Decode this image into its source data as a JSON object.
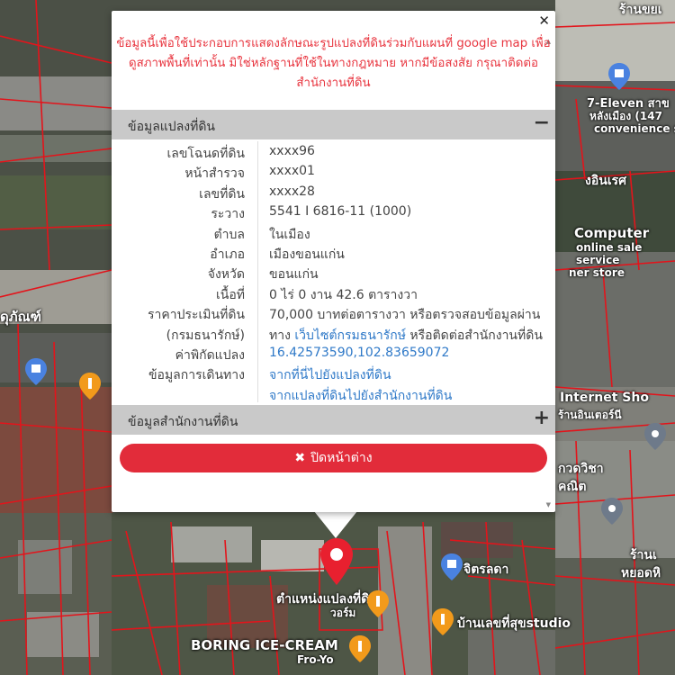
{
  "popup": {
    "close_glyph": "✕",
    "disclaimer": "ข้อมูลนี้เพื่อใช้ประกอบการแสดงลักษณะรูปแปลงที่ดินร่วมกับแผนที่ google map เพื่อดูสภาพพื้นที่เท่านั้น มิใช่หลักฐานที่ใช้ในทางกฎหมาย หากมีข้อสงสัย กรุณาติดต่อสำนักงานที่ดิน",
    "panel1": {
      "title": "ข้อมูลแปลงที่ดิน",
      "toggle": "−",
      "rows": [
        {
          "label": "เลขโฉนดที่ดิน",
          "value": "xxxx96"
        },
        {
          "label": "หน้าสำรวจ",
          "value": "xxxx01"
        },
        {
          "label": "เลขที่ดิน",
          "value": "xxxx28"
        },
        {
          "label": "ระวาง",
          "value": "5541 I 6816-11 (1000)"
        },
        {
          "label": "ตำบล",
          "value": "ในเมือง"
        },
        {
          "label": "อำเภอ",
          "value": "เมืองขอนแก่น"
        },
        {
          "label": "จังหวัด",
          "value": "ขอนแก่น"
        },
        {
          "label": "เนื้อที่",
          "value": "0 ไร่ 0 งาน 42.6 ตารางวา"
        }
      ],
      "price": {
        "label_line1": "ราคาประเมินที่ดิน",
        "label_line2": "(กรมธนารักษ์)",
        "value_line1": "70,000 บาทต่อตารางวา หรือตรวจสอบข้อมูลผ่าน",
        "value_line2_pre": "ทาง ",
        "value_line2_link": "เว็บไซต์กรมธนารักษ์",
        "value_line2_post": " หรือติดต่อสำนักงานที่ดิน"
      },
      "coords": {
        "label": "ค่าพิกัดแปลง",
        "value": "16.42573590,102.83659072"
      },
      "travel": {
        "label": "ข้อมูลการเดินทาง",
        "link1": "จากที่นี่ไปยังแปลงที่ดิน",
        "link2": "จากแปลงที่ดินไปยังสำนักงานที่ดิน"
      }
    },
    "panel2": {
      "title": "ข้อมูลสำนักงานที่ดิน",
      "toggle": "+"
    },
    "close_button": {
      "icon": "✖",
      "label": "ปิดหน้าต่าง"
    }
  },
  "map": {
    "labels": {
      "seven_eleven": "7-Eleven สาข",
      "seven_eleven_2": "หลังเมือง (147",
      "convenience": "convenience s",
      "computer": "Computer",
      "online_sale": "online sale",
      "service": "service",
      "ner_store": "ner store",
      "dupan": "ดุภัณฑ์",
      "internet": "Internet Sho",
      "internet_sub": "ร้านอินเตอร์นี",
      "kwidcha": "กวดวิชา",
      "kanid": "คณิต",
      "jitlada": "จิตรลดา",
      "marker_label": "ตำแหน่งแปลงที่ดิน",
      "warm": "วอร์ม",
      "baan": "บ้านเลขที่สุขstudio",
      "boring": "BORING ICE-CREAM",
      "froyo": "Fro-Yo",
      "top_right": "ร้านขยเ",
      "shop_right": "ร้านเ",
      "doi": "หยอดหิ",
      "inst": "งอินเรศ"
    },
    "marker_color": "#e8202f",
    "parcel_line_color": "#e3141b"
  }
}
